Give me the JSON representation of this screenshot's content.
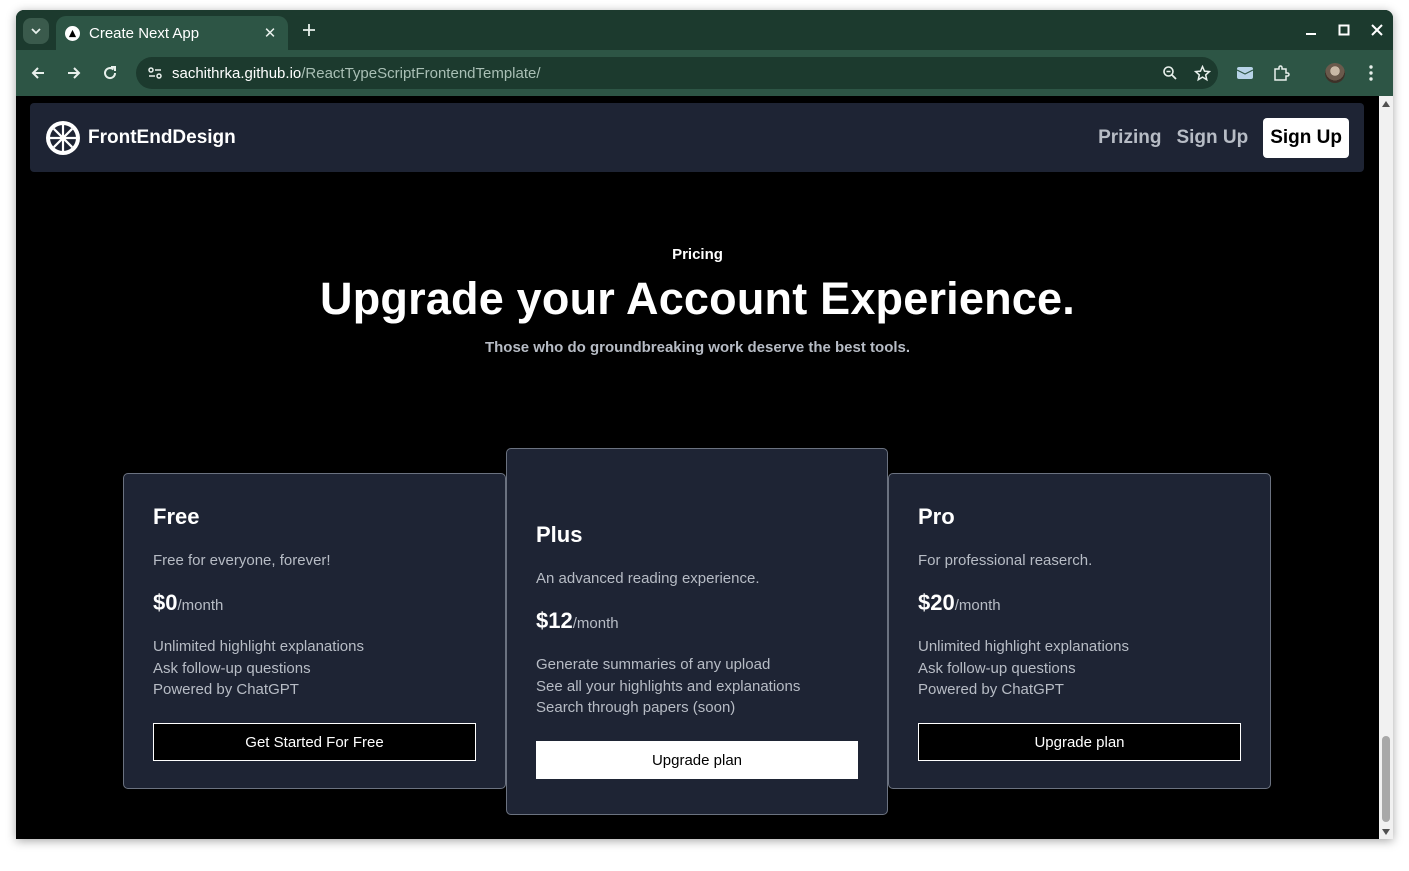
{
  "browser": {
    "tab_title": "Create Next App",
    "url_host": "sachithrka.github.io",
    "url_path": "/ReactTypeScriptFrontendTemplate/"
  },
  "site": {
    "brand": "FrontEndDesign",
    "nav": [
      "Prizing",
      "Sign Up"
    ],
    "cta": "Sign Up"
  },
  "hero": {
    "eyebrow": "Pricing",
    "headline": "Upgrade your Account Experience.",
    "subhead": "Those who do groundbreaking work deserve the best tools."
  },
  "plans": [
    {
      "name": "Free",
      "description": "Free for everyone, forever!",
      "price": "$0",
      "period": "/month",
      "features": [
        "Unlimited highlight explanations",
        "Ask follow-up questions",
        "Powered by ChatGPT"
      ],
      "button": "Get Started For Free"
    },
    {
      "name": "Plus",
      "description": "An advanced reading experience.",
      "price": "$12",
      "period": "/month",
      "features": [
        "Generate summaries of any upload",
        "See all your highlights and explanations",
        "Search through papers (soon)"
      ],
      "button": "Upgrade plan"
    },
    {
      "name": "Pro",
      "description": "For professional reaserch.",
      "price": "$20",
      "period": "/month",
      "features": [
        "Unlimited highlight explanations",
        "Ask follow-up questions",
        "Powered by ChatGPT"
      ],
      "button": "Upgrade plan"
    }
  ],
  "colors": {
    "browser_frame": "#1c3a2e",
    "page_background": "#000000",
    "card_background": "#1e2434",
    "muted_text": "#b7bcc5"
  }
}
